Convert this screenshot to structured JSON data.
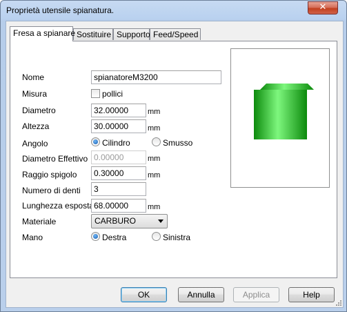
{
  "window": {
    "title": "Proprietà utensile spianatura.",
    "close_label": "✕"
  },
  "tabs": [
    {
      "label": "Fresa a spianare",
      "active": true
    },
    {
      "label": "Sostituire",
      "active": false
    },
    {
      "label": "Supporto",
      "active": false
    },
    {
      "label": "Feed/Speed",
      "active": false
    }
  ],
  "form": {
    "nome": {
      "label": "Nome",
      "value": "spianatoreM3200"
    },
    "misura": {
      "label": "Misura",
      "checkbox_label": "pollici",
      "checked": false
    },
    "diametro": {
      "label": "Diametro",
      "value": "32.00000",
      "unit": "mm"
    },
    "altezza": {
      "label": "Altezza",
      "value": "30.00000",
      "unit": "mm"
    },
    "angolo": {
      "label": "Angolo",
      "option1": "Cilindro",
      "option2": "Smusso",
      "selected": "Cilindro"
    },
    "diametro_effettivo": {
      "label": "Diametro Effettivo",
      "value": "0.00000",
      "unit": "mm"
    },
    "raggio_spigolo": {
      "label": "Raggio spigolo",
      "value": "0.30000",
      "unit": "mm"
    },
    "numero_denti": {
      "label": "Numero di denti",
      "value": "3"
    },
    "lunghezza_esposta": {
      "label": "Lunghezza esposta",
      "value": "68.00000",
      "unit": "mm"
    },
    "materiale": {
      "label": "Materiale",
      "value": "CARBURO"
    },
    "mano": {
      "label": "Mano",
      "option1": "Destra",
      "option2": "Sinistra",
      "selected": "Destra"
    }
  },
  "preview": {
    "body_color": "#2fd12f",
    "highlight_color": "#7ef77e",
    "shadow_color": "#0c8a0c"
  },
  "buttons": {
    "ok": "OK",
    "cancel": "Annulla",
    "apply": "Applica",
    "help": "Help"
  }
}
